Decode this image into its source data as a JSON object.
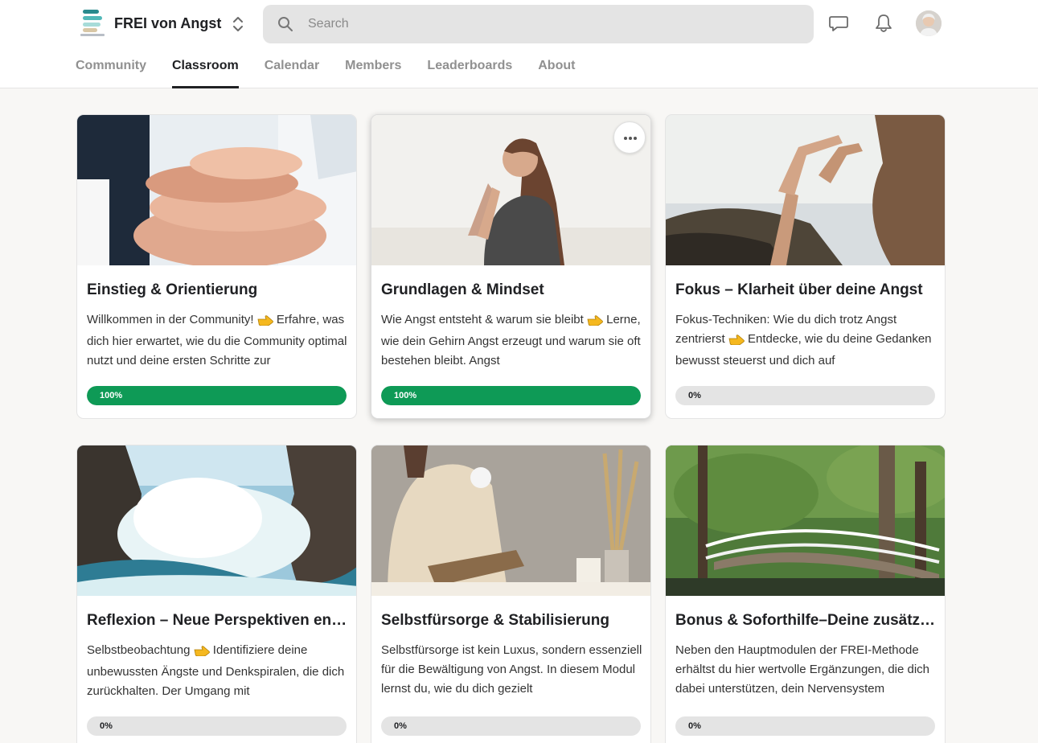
{
  "header": {
    "group_name": "FREI von Angst",
    "logo_caption": "FREI von Angst",
    "search_placeholder": "Search",
    "colors": {
      "accent_teal": "#2a8a8d",
      "progress_green": "#0e9a56",
      "track_gray": "#e4e4e4"
    }
  },
  "tabs": [
    {
      "label": "Community",
      "active": false
    },
    {
      "label": "Classroom",
      "active": true
    },
    {
      "label": "Calendar",
      "active": false
    },
    {
      "label": "Members",
      "active": false
    },
    {
      "label": "Leaderboards",
      "active": false
    },
    {
      "label": "About",
      "active": false
    }
  ],
  "courses": [
    {
      "title": "Einstieg & Orientierung",
      "desc_before": "Willkommen in der Community! ",
      "desc_after": " Erfahre, was dich hier erwartet, wie du die Community optimal nutzt und deine ersten Schritte zur",
      "progress_percent": 100,
      "progress_label": "100%"
    },
    {
      "title": "Grundlagen & Mindset",
      "desc_before": "Wie Angst entsteht & warum sie bleibt ",
      "desc_after": " Lerne, wie dein Gehirn Angst erzeugt und warum sie oft bestehen bleibt. Angst",
      "progress_percent": 100,
      "progress_label": "100%"
    },
    {
      "title": "Fokus – Klarheit über deine Angst",
      "desc_before": "Fokus-Techniken: Wie du dich trotz Angst zentrierst ",
      "desc_after": " Entdecke, wie du deine Gedanken bewusst steuerst und dich auf",
      "progress_percent": 0,
      "progress_label": "0%"
    },
    {
      "title": "Reflexion – Neue Perspektiven entwickeln",
      "desc_before": "Selbstbeobachtung ",
      "desc_after": " Identifiziere deine unbewussten Ängste und Denkspiralen, die dich zurückhalten. Der Umgang mit",
      "progress_percent": 0,
      "progress_label": "0%"
    },
    {
      "title": "Selbstfürsorge & Stabilisierung",
      "desc_before": "Selbstfürsorge ist kein Luxus, sondern essenziell für die Bewältigung von Angst. In diesem Modul lernst du, wie du dich gezielt",
      "desc_after": "",
      "progress_percent": 0,
      "progress_label": "0%"
    },
    {
      "title": "Bonus & Soforthilfe–Deine zusätzlichen Tools",
      "desc_before": "Neben den Hauptmodulen der FREI-Methode erhältst du hier wertvolle Ergänzungen, die dich dabei unterstützen, dein Nervensystem",
      "desc_after": "",
      "progress_percent": 0,
      "progress_label": "0%"
    }
  ]
}
